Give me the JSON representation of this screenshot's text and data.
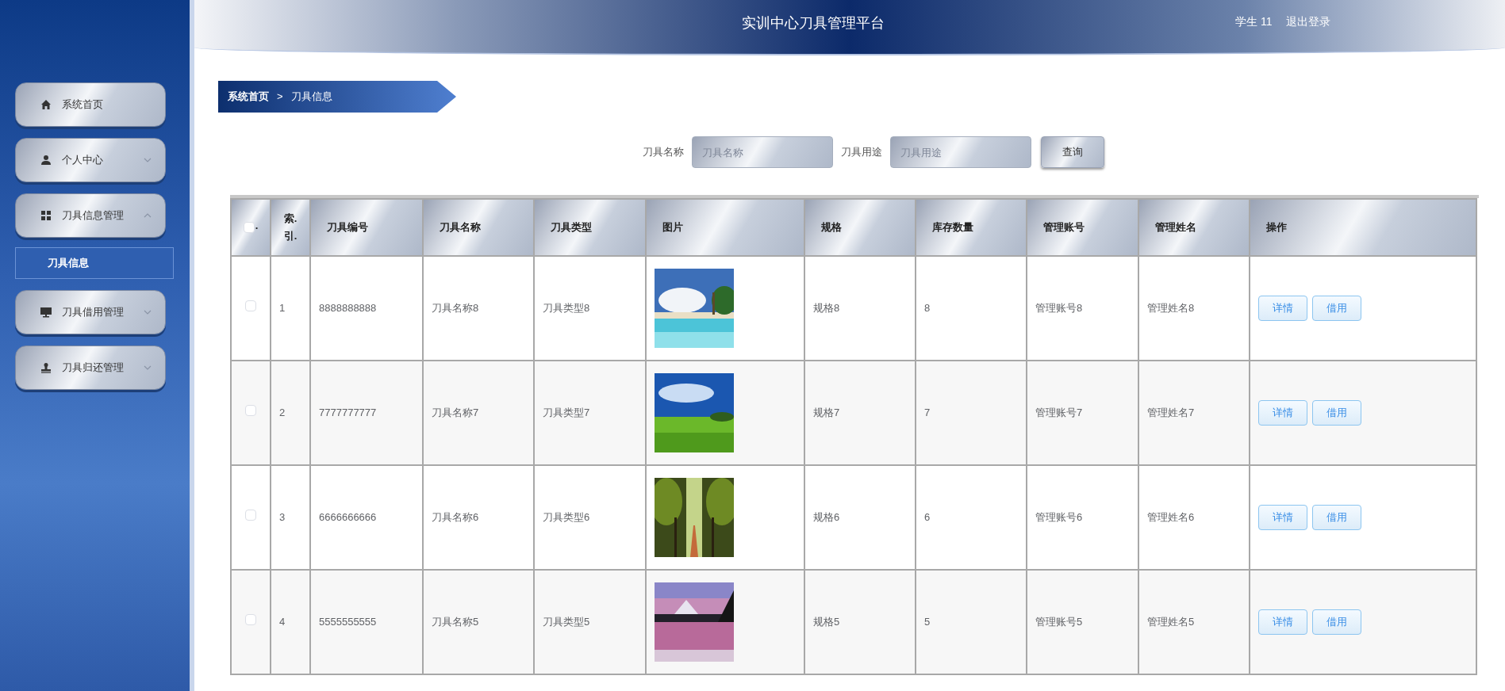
{
  "header": {
    "title": "实训中心刀具管理平台",
    "user": "学生 11",
    "logout": "退出登录"
  },
  "sidebar": {
    "items": [
      {
        "label": "系统首页"
      },
      {
        "label": "个人中心",
        "expanded": false
      },
      {
        "label": "刀具信息管理",
        "expanded": true,
        "children": [
          {
            "label": "刀具信息",
            "selected": true
          }
        ]
      },
      {
        "label": "刀具借用管理",
        "expanded": false
      },
      {
        "label": "刀具归还管理",
        "expanded": false
      }
    ]
  },
  "breadcrumb": [
    "系统首页",
    ">",
    "刀具信息"
  ],
  "search": {
    "fields": [
      {
        "label": "刀具名称",
        "placeholder": "刀具名称"
      },
      {
        "label": "刀具用途",
        "placeholder": "刀具用途"
      }
    ],
    "button": "查询"
  },
  "table": {
    "select_all": {
      "checked": false
    },
    "select_all_suffix": ".",
    "columns": [
      "索.\n引.",
      "刀具编号",
      "刀具名称",
      "刀具类型",
      "图片",
      "规格",
      "库存数量",
      "管理账号",
      "管理姓名",
      "操作"
    ],
    "rows": [
      {
        "checked": false,
        "index": "1",
        "code": "8888888888",
        "name": "刀具名称8",
        "type": "刀具类型8",
        "spec": "规格8",
        "stock": "8",
        "account": "管理账号8",
        "manager": "管理姓名8",
        "actions": [
          "详情",
          "借用"
        ]
      },
      {
        "checked": false,
        "index": "2",
        "code": "7777777777",
        "name": "刀具名称7",
        "type": "刀具类型7",
        "spec": "规格7",
        "stock": "7",
        "account": "管理账号7",
        "manager": "管理姓名7",
        "actions": [
          "详情",
          "借用"
        ]
      },
      {
        "checked": false,
        "index": "3",
        "code": "6666666666",
        "name": "刀具名称6",
        "type": "刀具类型6",
        "spec": "规格6",
        "stock": "6",
        "account": "管理账号6",
        "manager": "管理姓名6",
        "actions": [
          "详情",
          "借用"
        ]
      },
      {
        "checked": false,
        "index": "4",
        "code": "5555555555",
        "name": "刀具名称5",
        "type": "刀具类型5",
        "spec": "规格5",
        "stock": "5",
        "account": "管理账号5",
        "manager": "管理姓名5",
        "actions": [
          "详情",
          "借用"
        ]
      }
    ]
  }
}
